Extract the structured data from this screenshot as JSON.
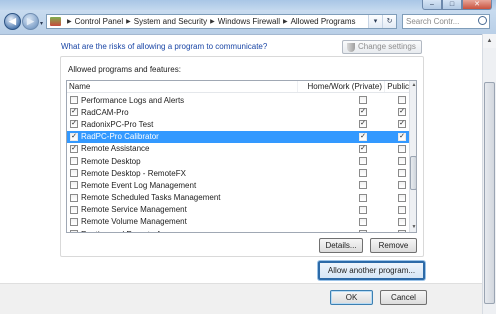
{
  "window": {
    "minimize": "–",
    "maximize": "□",
    "close": "✕"
  },
  "address": {
    "crumbs": [
      "Control Panel",
      "System and Security",
      "Windows Firewall",
      "Allowed Programs"
    ],
    "separator": "▶",
    "dropdown": "▾",
    "refresh": "↻"
  },
  "search": {
    "placeholder": "Search Contr..."
  },
  "nav": {
    "back": "◀",
    "forward": "▶",
    "recent": "▾"
  },
  "content": {
    "risks_link": "What are the risks of allowing a program to communicate?",
    "change_settings": "Change settings",
    "group_label": "Allowed programs and features:",
    "columns": {
      "name": "Name",
      "home": "Home/Work (Private)",
      "public": "Public"
    },
    "programs": [
      {
        "name": "Performance Logs and Alerts",
        "enabled": "",
        "home": "",
        "public": ""
      },
      {
        "name": "RadCAM-Pro",
        "enabled": "✓",
        "home": "✓",
        "public": "✓"
      },
      {
        "name": "RadonixPC-Pro Test",
        "enabled": "✓",
        "home": "✓",
        "public": "✓"
      },
      {
        "name": "RadPC-Pro Calibrator",
        "enabled": "✓",
        "home": "✓",
        "public": "✓",
        "selected": true
      },
      {
        "name": "Remote Assistance",
        "enabled": "✓",
        "home": "✓",
        "public": ""
      },
      {
        "name": "Remote Desktop",
        "enabled": "",
        "home": "",
        "public": ""
      },
      {
        "name": "Remote Desktop - RemoteFX",
        "enabled": "",
        "home": "",
        "public": ""
      },
      {
        "name": "Remote Event Log Management",
        "enabled": "",
        "home": "",
        "public": ""
      },
      {
        "name": "Remote Scheduled Tasks Management",
        "enabled": "",
        "home": "",
        "public": ""
      },
      {
        "name": "Remote Service Management",
        "enabled": "",
        "home": "",
        "public": ""
      },
      {
        "name": "Remote Volume Management",
        "enabled": "",
        "home": "",
        "public": ""
      },
      {
        "name": "Routing and Remote Access",
        "enabled": "",
        "home": "",
        "public": ""
      }
    ],
    "details_button": "Details...",
    "remove_button": "Remove",
    "allow_button": "Allow another program..."
  },
  "footer": {
    "ok": "OK",
    "cancel": "Cancel"
  },
  "scroll": {
    "up": "▲",
    "down": "▼"
  },
  "colors": {
    "selection": "#3399ff",
    "link": "#1a46a6",
    "focus_border": "#2c6aa8"
  }
}
